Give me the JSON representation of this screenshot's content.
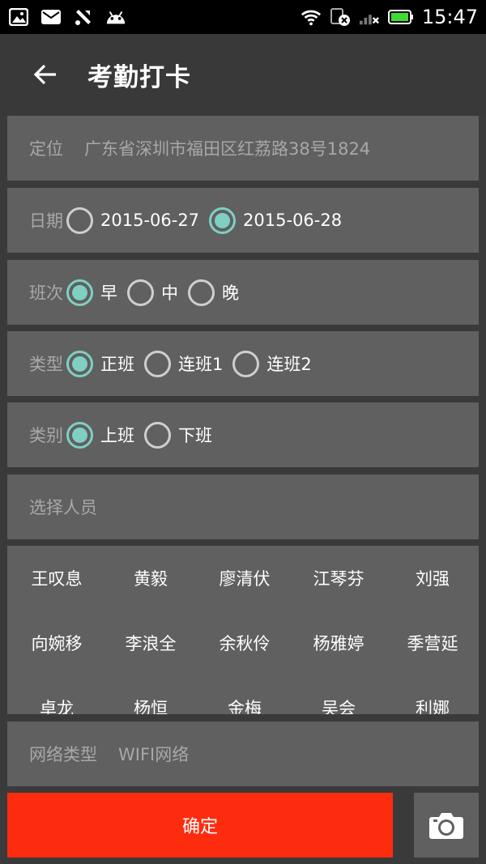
{
  "status_bar": {
    "time": "15:47",
    "icons": [
      "gallery-icon",
      "mail-icon",
      "tools-icon",
      "android-icon",
      "wifi-icon",
      "sim-error-icon",
      "signal-icon",
      "battery-icon"
    ],
    "battery_color": "#3ddc2f"
  },
  "app_bar": {
    "title": "考勤打卡",
    "back_icon": "arrow-left-icon"
  },
  "location": {
    "label": "定位",
    "value": "广东省深圳市福田区红荔路38号1824"
  },
  "date": {
    "label": "日期",
    "options": [
      {
        "label": "2015-06-27",
        "checked": false
      },
      {
        "label": "2015-06-28",
        "checked": true
      }
    ]
  },
  "shift": {
    "label": "班次",
    "options": [
      {
        "label": "早",
        "checked": true
      },
      {
        "label": "中",
        "checked": false
      },
      {
        "label": "晚",
        "checked": false
      }
    ]
  },
  "type": {
    "label": "类型",
    "options": [
      {
        "label": "正班",
        "checked": true
      },
      {
        "label": "连班1",
        "checked": false
      },
      {
        "label": "连班2",
        "checked": false
      }
    ]
  },
  "category": {
    "label": "类别",
    "options": [
      {
        "label": "上班",
        "checked": true
      },
      {
        "label": "下班",
        "checked": false
      }
    ]
  },
  "select_person": {
    "placeholder": "选择人员"
  },
  "people": [
    "王叹息",
    "黄毅",
    "廖清伏",
    "江琴芬",
    "刘强",
    "向婉移",
    "李浪全",
    "余秋伶",
    "杨雅婷",
    "季营延",
    "卓龙",
    "杨恒",
    "金梅",
    "吴会",
    "利娜"
  ],
  "network": {
    "label": "网络类型",
    "value": "WIFI网络"
  },
  "confirm": {
    "label": "确定"
  },
  "camera": {
    "icon": "camera-icon"
  },
  "colors": {
    "accent": "#7fcfc3",
    "confirm": "#fe2c0f",
    "card": "#606060",
    "background": "#3a3a3a"
  }
}
